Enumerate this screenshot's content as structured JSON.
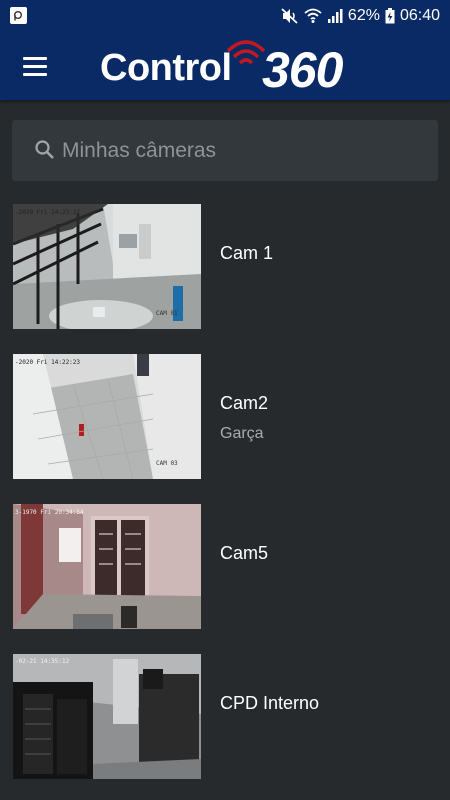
{
  "status_bar": {
    "app_icon": "notification-app-icon",
    "icons": [
      "mute-icon",
      "wifi-icon",
      "signal-icon",
      "battery-charging-icon"
    ],
    "battery": "62%",
    "time": "06:40"
  },
  "app_bar": {
    "menu_icon": "hamburger-menu-icon",
    "logo_word": "Control",
    "logo_number": "360",
    "brand_color": "#0a2a66",
    "logo_accent_color": "#c0191f"
  },
  "search": {
    "placeholder": "Minhas câmeras",
    "value": ""
  },
  "cameras": [
    {
      "name": "Cam 1",
      "subtitle": "",
      "thumb_osd": "-2020 Fri 14:23:22",
      "thumb_channel": "CAM 01"
    },
    {
      "name": "Cam2",
      "subtitle": "Garça",
      "thumb_osd": "-2020 Fri 14:22:23",
      "thumb_channel": "CAM 03"
    },
    {
      "name": "Cam5",
      "subtitle": "",
      "thumb_osd": "3-1970 Fri 20:34:54",
      "thumb_channel": ""
    },
    {
      "name": "CPD Interno",
      "subtitle": "",
      "thumb_osd": "-02-21 14:35:12",
      "thumb_channel": ""
    }
  ]
}
